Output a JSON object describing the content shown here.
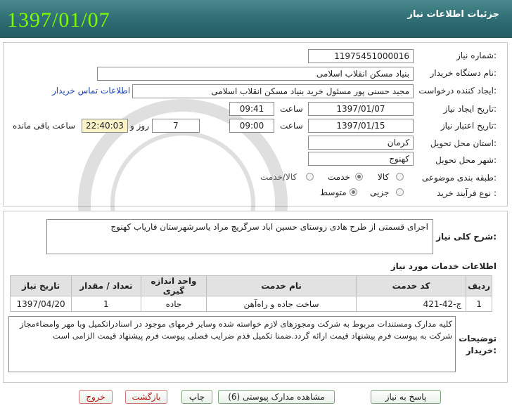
{
  "header": {
    "date": "1397/01/07",
    "title": "جزئیات اطلاعات نیاز"
  },
  "fields": {
    "need_number_label": "شماره نیاز:",
    "need_number": "11975451000016",
    "buyer_org_label": "نام دستگاه خریدار:",
    "buyer_org": "بنیاد مسکن انقلاب اسلامی",
    "creator_label": "ایجاد کننده درخواست:",
    "creator": "مجید حسنی پور مسئول خرید بنیاد مسکن انقلاب اسلامی",
    "contact_link": "اطلاعات تماس خریدار",
    "create_date_label": "تاریخ ایجاد نیاز:",
    "create_date": "1397/01/07",
    "time_label": "ساعت",
    "create_time": "09:41",
    "validity_label": "تاریخ اعتبار نیاز:",
    "validity_date": "1397/01/15",
    "validity_time": "09:00",
    "days_label": "روز و",
    "days": "7",
    "remaining_time": "22:40:03",
    "remaining_label": "ساعت باقی مانده",
    "province_label": "استان محل تحویل:",
    "province": "کرمان",
    "city_label": "شهر محل تحویل:",
    "city": "کهنوج",
    "category_label": "طبقه بندی موضوعی:",
    "category_options": [
      "کالا",
      "خدمت",
      "کالا/خدمت"
    ],
    "purchase_type_label": "نوع فرآیند خرید :",
    "purchase_options": [
      "جزیی",
      "متوسط"
    ]
  },
  "description": {
    "label": "شرح کلی نیاز:",
    "text": "اجرای قسمتی از طرح هادی روستای حسین اباد سرگریچ مراد یاسرشهرستان  فاریاب کهنوج"
  },
  "services": {
    "title": "اطلاعات خدمات مورد نیاز",
    "columns": [
      "ردیف",
      "کد خدمت",
      "نام خدمت",
      "واحد اندازه گیری",
      "تعداد / مقدار",
      "تاریخ نیاز"
    ],
    "rows": [
      [
        "1",
        "ج-42-421",
        "ساخت جاده و راه‌آهن",
        "جاده",
        "1",
        "1397/04/20"
      ]
    ]
  },
  "notes": {
    "label_1": "توضیحات",
    "label_2": "خریدار:",
    "text": "کلیه مدارک ومستندات مربوط به شرکت ومجوزهای لازم خواسته شده وسایر فرمهای موجود در اسنادراتکمیل وبا مهر وامضاءمجاز شرکت به پیوست فرم پیشنهاد قیمت ارائه گردد.ضمنا تکمیل فذم ضرایب فصلی پیوست فرم پیشنهاد قیمت الزامی است"
  },
  "buttons": {
    "reply": "پاسخ به نیاز",
    "attachments": "مشاهده مدارک پیوستی (6)",
    "print": "چاپ",
    "back": "بازگشت",
    "exit": "خروج"
  },
  "colors": {
    "header_bg": "#2e6e74",
    "date_green": "#7CFC00",
    "link_blue": "#1a3fb0",
    "remaining_bg": "#fbf3c8"
  }
}
